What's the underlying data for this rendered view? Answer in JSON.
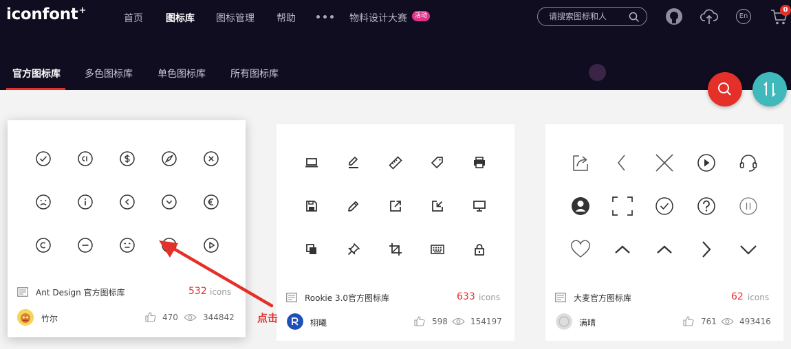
{
  "header": {
    "logo": "iconfont",
    "logo_mark": "+",
    "nav": [
      {
        "label": "首页",
        "active": false
      },
      {
        "label": "图标库",
        "active": true
      },
      {
        "label": "图标管理",
        "active": false
      },
      {
        "label": "帮助",
        "active": false
      }
    ],
    "contest": {
      "label": "物料设计大赛",
      "badge": "活动"
    },
    "search": {
      "placeholder": "请搜索图标和人"
    },
    "lang": "En",
    "cart_count": "0"
  },
  "subtabs": [
    {
      "label": "官方图标库",
      "active": true
    },
    {
      "label": "多色图标库",
      "active": false
    },
    {
      "label": "单色图标库",
      "active": false
    },
    {
      "label": "所有图标库",
      "active": false
    }
  ],
  "cards": [
    {
      "name": "Ant Design 官方图标库",
      "icon_count": "532",
      "icons_unit": "icons",
      "author": "竹尔",
      "likes": "470",
      "views": "344842",
      "icons": [
        "check-circle-icon",
        "copyright-circle-icon",
        "dollar-circle-icon",
        "compass-icon",
        "close-circle-icon",
        "frown-icon",
        "info-circle-icon",
        "left-circle-icon",
        "down-circle-icon",
        "euro-circle-icon",
        "copyright-icon",
        "minus-circle-icon",
        "meh-icon",
        "star-circle-icon",
        "play-circle-icon"
      ]
    },
    {
      "name": "Rookie 3.0官方图标库",
      "icon_count": "633",
      "icons_unit": "icons",
      "author": "栩曦",
      "likes": "598",
      "views": "154197",
      "icons": [
        "laptop-icon",
        "edit-underline-icon",
        "ruler-icon",
        "tag-icon",
        "printer-icon",
        "save-icon",
        "pencil-icon",
        "export-icon",
        "import-icon",
        "monitor-icon",
        "copy-icon",
        "pin-icon",
        "crop-icon",
        "keyboard-icon",
        "lock-icon"
      ]
    },
    {
      "name": "大麦官方图标库",
      "icon_count": "62",
      "icons_unit": "icons",
      "author": "满晴",
      "likes": "761",
      "views": "493416",
      "icons": [
        "share-icon",
        "chevron-left-icon",
        "close-icon",
        "play-circle-icon",
        "headset-icon",
        "user-circle-icon",
        "scan-icon",
        "check-circle-icon",
        "question-circle-icon",
        "pause-circle-icon",
        "heart-icon",
        "chevron-up-icon",
        "chevron-up-icon",
        "chevron-right-icon",
        "chevron-down-icon"
      ]
    }
  ],
  "annotation": {
    "label": "点击"
  },
  "colors": {
    "header_bg": "#100d20",
    "accent": "#e5302a",
    "teal": "#3fb9bc"
  }
}
